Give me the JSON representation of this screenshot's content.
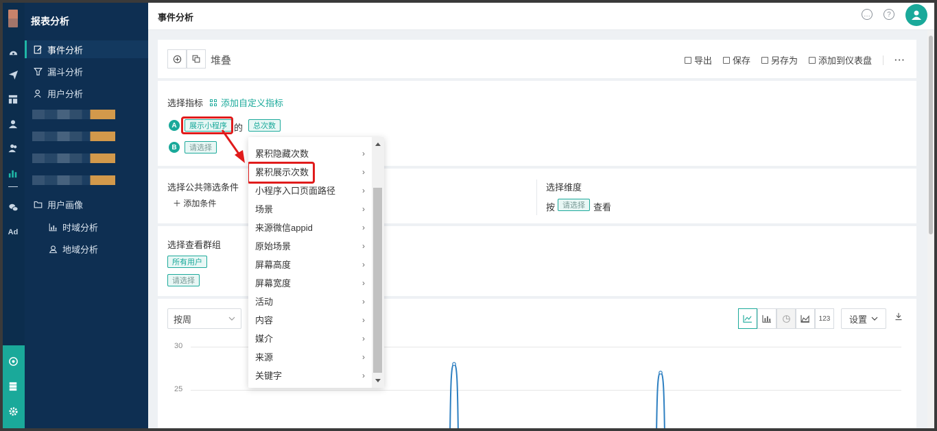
{
  "app": {
    "title": "报表分析",
    "page_title": "事件分析"
  },
  "sidebar": {
    "items": [
      {
        "label": "事件分析",
        "icon": "edit-icon",
        "active": true
      },
      {
        "label": "漏斗分析",
        "icon": "funnel-icon"
      },
      {
        "label": "用户分析",
        "icon": "user-icon"
      },
      {
        "label": "用户画像",
        "icon": "folder-icon"
      },
      {
        "label": "时域分析",
        "icon": "bar-chart-icon"
      },
      {
        "label": "地域分析",
        "icon": "location-icon"
      }
    ]
  },
  "rail": {
    "icons": [
      "dashboard-icon",
      "send-icon",
      "layout-icon",
      "user-icon",
      "users-icon",
      "chart-icon",
      "wechat-icon",
      "ad-icon",
      "target-icon",
      "server-icon",
      "settings-icon"
    ],
    "ad_label": "Ad"
  },
  "toolbar": {
    "stack_label": "堆叠",
    "export": "导出",
    "save": "保存",
    "save_as": "另存为",
    "add_dashboard": "添加到仪表盘",
    "more": "···"
  },
  "metrics": {
    "label": "选择指标",
    "add_custom": "添加自定义指标",
    "row_a_badge": "A",
    "row_a_event": "展示小程序",
    "row_a_of": "的",
    "row_a_metric": "总次数",
    "row_b_badge": "B",
    "row_b_placeholder": "请选择"
  },
  "filters": {
    "label": "选择公共筛选条件",
    "add": "添加条件",
    "dimension_label": "选择维度",
    "by": "按",
    "dimension_placeholder": "请选择",
    "view": "查看"
  },
  "groups": {
    "label": "选择查看群组",
    "all_users": "所有用户",
    "placeholder": "请选择"
  },
  "dropdown": {
    "items": [
      "累积隐藏次数",
      "累积展示次数",
      "小程序入口页面路径",
      "场景",
      "来源微信appid",
      "原始场景",
      "屏幕高度",
      "屏幕宽度",
      "活动",
      "内容",
      "媒介",
      "来源",
      "关键字"
    ],
    "highlighted": "累积展示次数"
  },
  "chart": {
    "period": "按周",
    "settings": "设置",
    "number_type": "123",
    "y_ticks": [
      "30",
      "25"
    ]
  },
  "chart_data": {
    "type": "line",
    "title": "",
    "xlabel": "",
    "ylabel": "",
    "ylim": [
      20,
      30
    ],
    "series": [
      {
        "values": [
          20,
          28,
          20,
          27,
          20
        ]
      }
    ]
  },
  "colors": {
    "accent": "#1aa99a",
    "sidebar": "#0e2f52",
    "highlight": "#e01b1b",
    "line": "#2d7fc1"
  }
}
